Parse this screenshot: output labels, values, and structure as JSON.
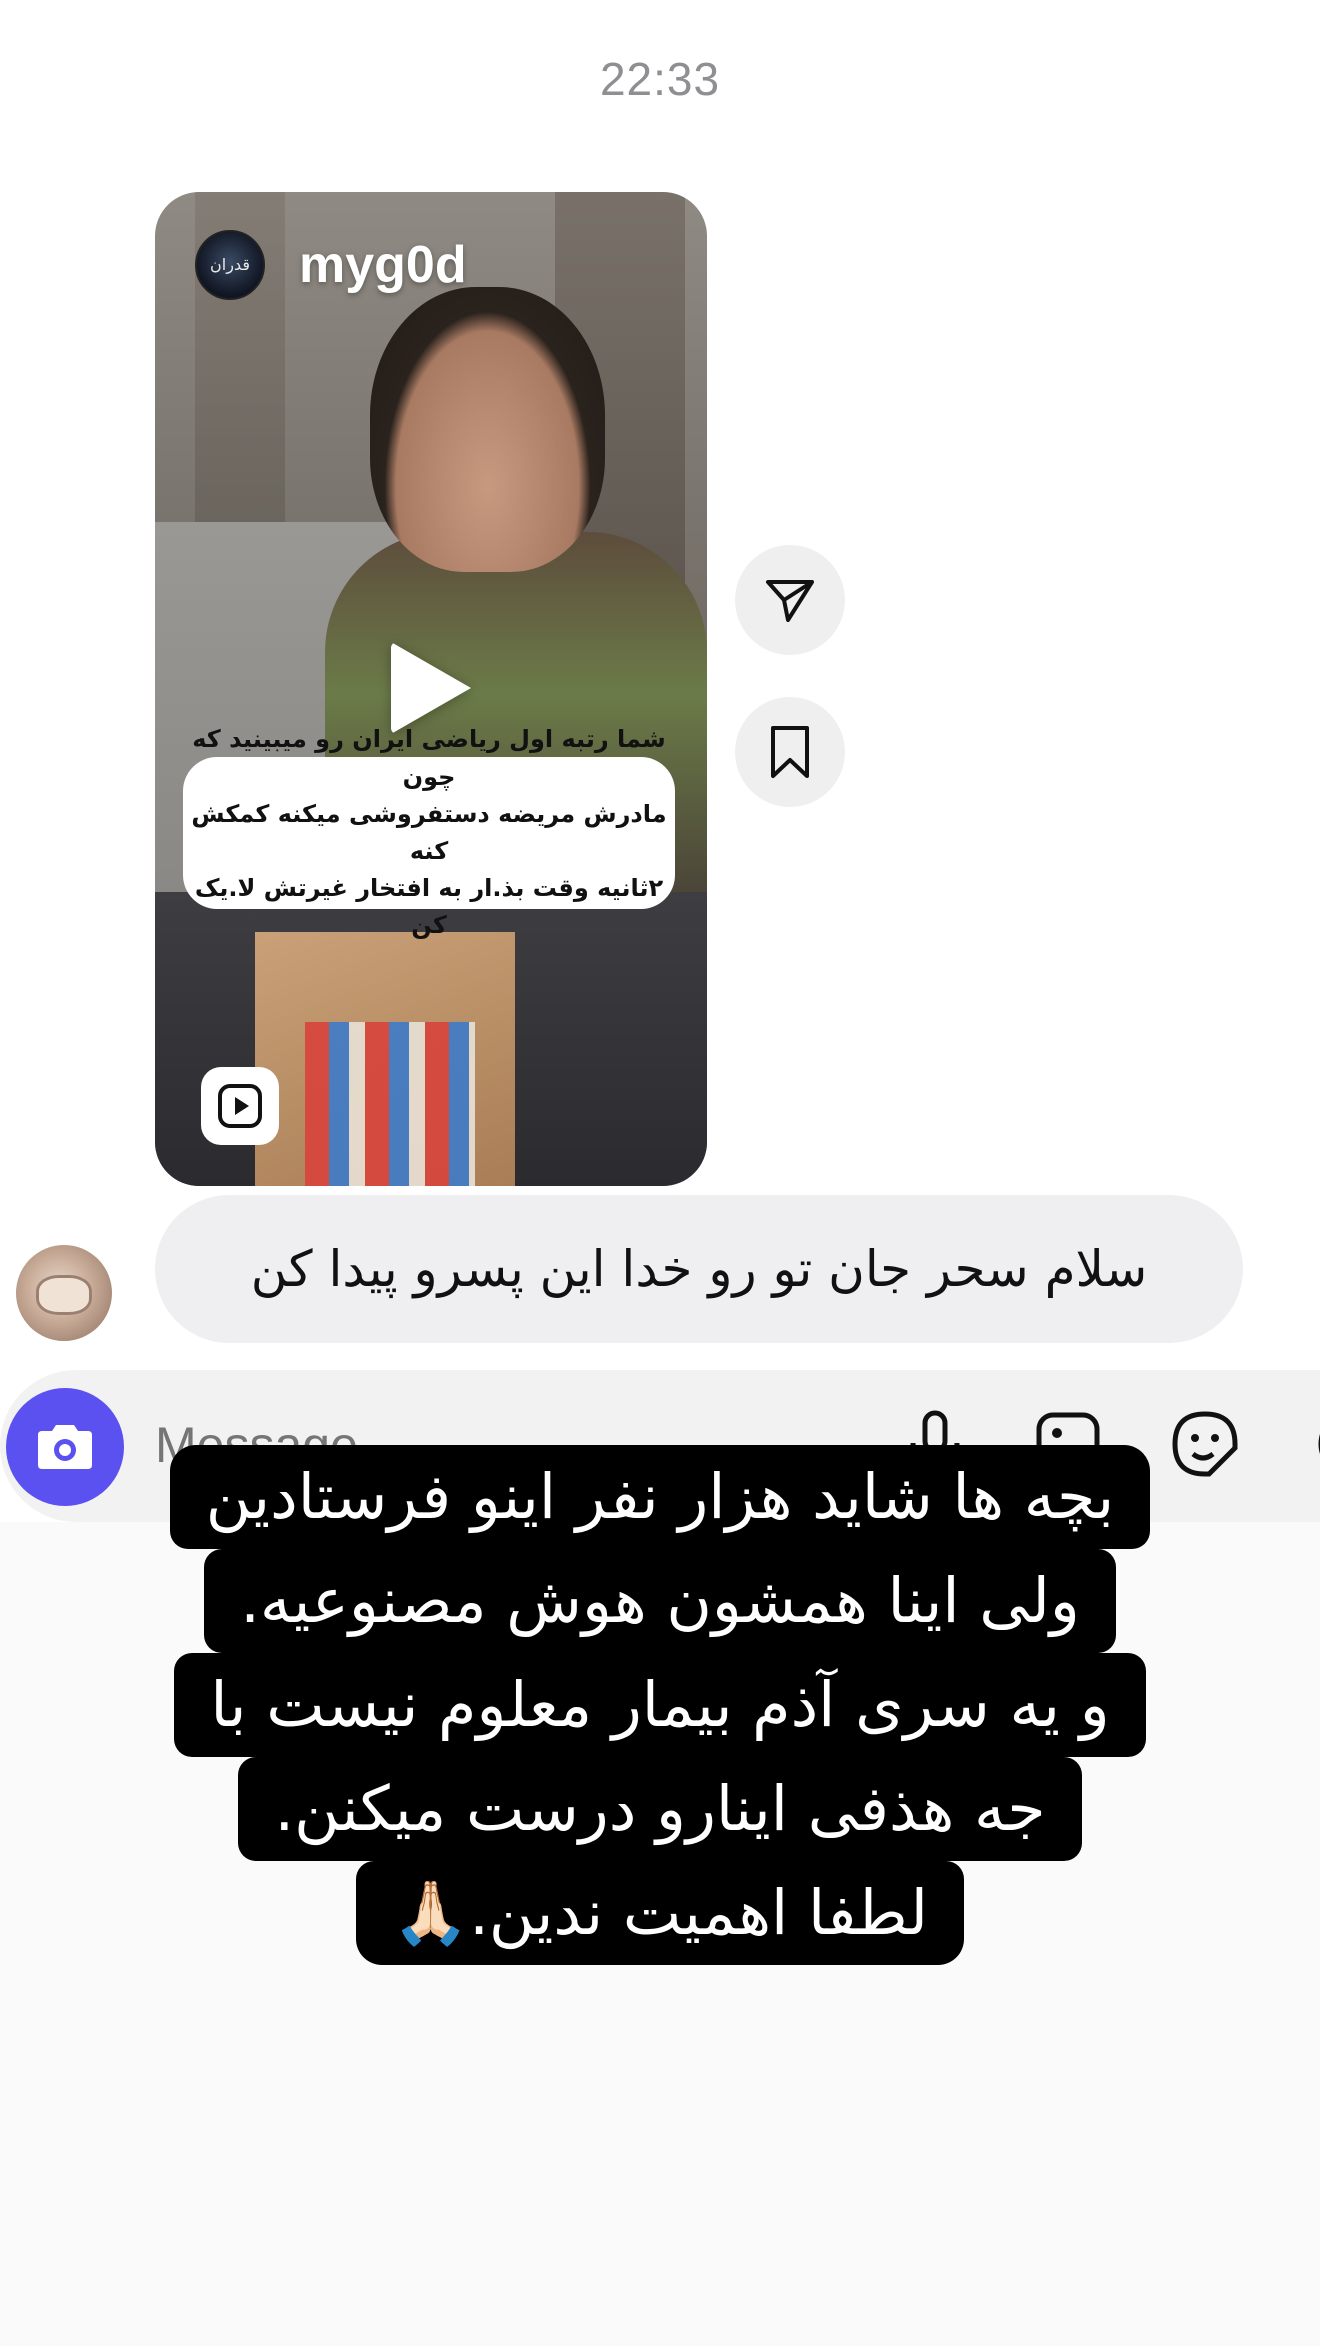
{
  "chat": {
    "timestamp": "22:33"
  },
  "shared_reel": {
    "username": "myg0d",
    "avatar_text": "قدران",
    "caption_lines": [
      "شما رتبه اول ریاضی ایران رو میبینید که چون",
      "مادرش مریضه دستفروشی میکنه کمکش کنه",
      "۲ثانیه وقت بذ.ار به افتخار غیرتش لا.یک کن"
    ],
    "icons": {
      "center": "play-icon",
      "badge": "reels-icon",
      "share": "paper-plane-icon",
      "save": "bookmark-icon"
    }
  },
  "message": {
    "text": "سلام سحر جان تو رو خدا این پسرو پیدا کن"
  },
  "composer": {
    "placeholder": "Message",
    "icons": [
      "camera-icon",
      "microphone-icon",
      "gallery-icon",
      "sticker-icon",
      "plus-icon"
    ],
    "accent_color": "#5b51f0"
  },
  "overlay_text": {
    "lines": [
      "بچه ها شاید هزار نفر اینو فرستادین",
      "ولی اینا همشون هوش مصنوعیه.",
      "و یه سری آذم بیمار معلوم نیست با",
      "جه هذفی اینارو درست میکنن.",
      "لطفا اهمیت ندین.🙏🏻"
    ]
  }
}
